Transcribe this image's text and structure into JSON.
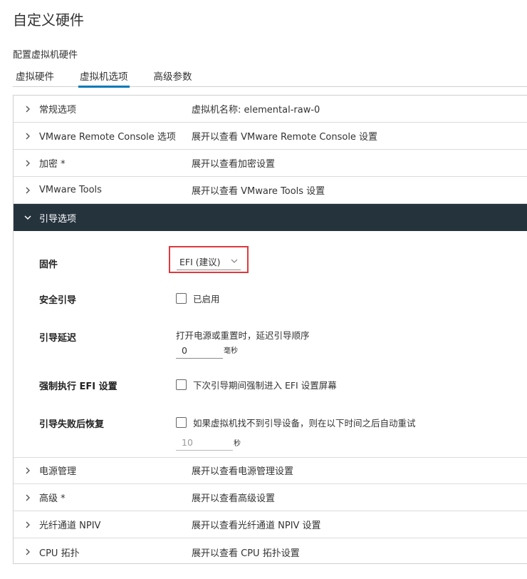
{
  "page_title": "自定义硬件",
  "subtitle": "配置虚拟机硬件",
  "tabs": [
    {
      "label": "虚拟硬件"
    },
    {
      "label": "虚拟机选项"
    },
    {
      "label": "高级参数"
    }
  ],
  "sections_top": [
    {
      "label": "常规选项",
      "value": "虚拟机名称: elemental-raw-0"
    },
    {
      "label": "VMware Remote Console 选项",
      "value": "展开以查看 VMware Remote Console 设置"
    },
    {
      "label": "加密 *",
      "value": "展开以查看加密设置"
    },
    {
      "label": "VMware Tools",
      "value": "展开以查看 VMware Tools 设置"
    }
  ],
  "boot": {
    "label": "引导选项",
    "firmware": {
      "label": "固件",
      "value": "EFI (建议)"
    },
    "secure_boot": {
      "label": "安全引导",
      "checkbox_text": "已启用"
    },
    "boot_delay": {
      "label": "引导延迟",
      "description": "打开电源或重置时，延迟引导顺序",
      "value": "0",
      "unit": "毫秒"
    },
    "force_efi": {
      "label": "强制执行 EFI 设置",
      "checkbox_text": "下次引导期间强制进入 EFI 设置屏幕"
    },
    "failed_recovery": {
      "label": "引导失败后恢复",
      "checkbox_text": "如果虚拟机找不到引导设备，则在以下时间之后自动重试",
      "value": "10",
      "unit": "秒"
    }
  },
  "sections_bottom": [
    {
      "label": "电源管理",
      "value": "展开以查看电源管理设置"
    },
    {
      "label": "高级 *",
      "value": "展开以查看高级设置"
    },
    {
      "label": "光纤通道 NPIV",
      "value": "展开以查看光纤通道 NPIV 设置"
    },
    {
      "label": "CPU 拓扑",
      "value": "展开以查看 CPU 拓扑设置"
    }
  ],
  "colors": {
    "accent": "#0079b8",
    "expanded_header": "#25333d",
    "highlight": "#e0383e"
  }
}
